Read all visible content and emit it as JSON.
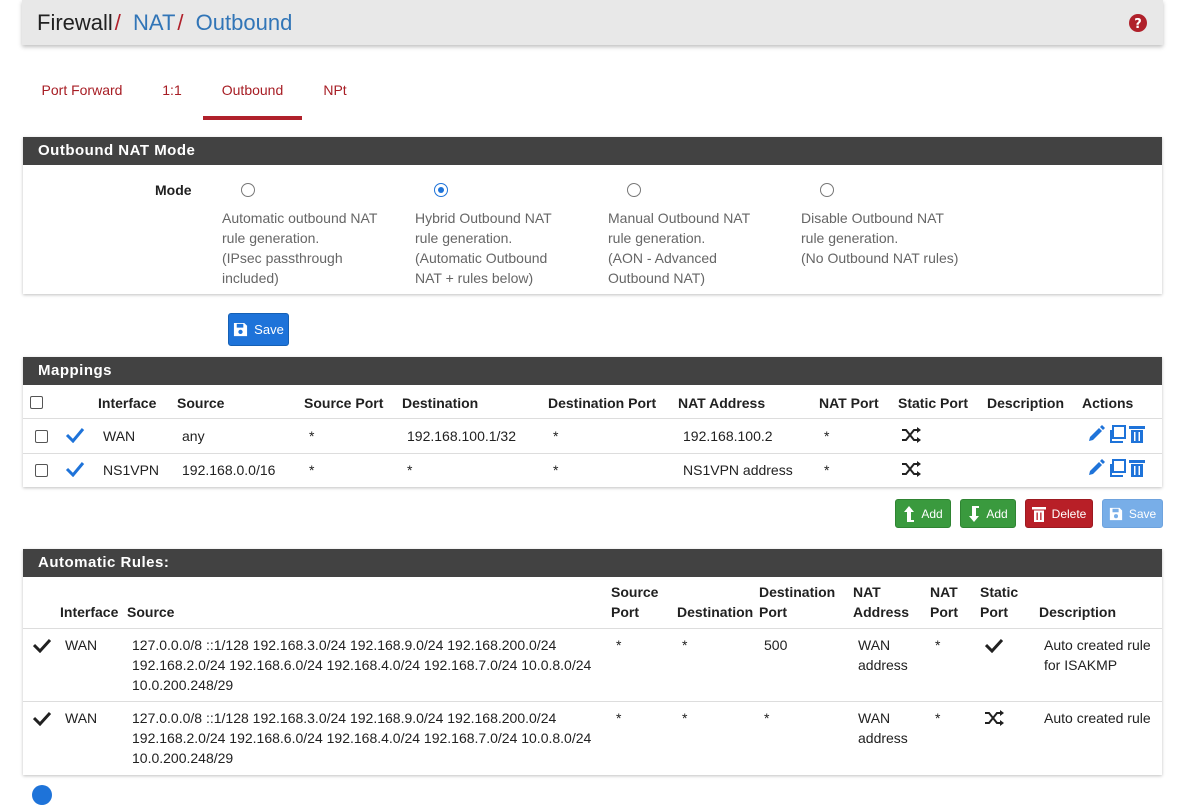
{
  "breadcrumb": {
    "first": "Firewall",
    "second": "NAT",
    "third": "Outbound",
    "separator": "/"
  },
  "tabs": [
    {
      "label": "Port Forward",
      "active": false
    },
    {
      "label": "1:1",
      "active": false
    },
    {
      "label": "Outbound",
      "active": true
    },
    {
      "label": "NPt",
      "active": false
    }
  ],
  "mode_panel": {
    "title": "Outbound NAT Mode",
    "mode_label": "Mode",
    "options": [
      {
        "lines": [
          "Automatic outbound NAT",
          "rule generation.",
          "(IPsec passthrough",
          "included)"
        ],
        "selected": false
      },
      {
        "lines": [
          "Hybrid Outbound NAT",
          "rule generation.",
          "(Automatic Outbound",
          "NAT + rules below)"
        ],
        "selected": true
      },
      {
        "lines": [
          "Manual Outbound NAT",
          "rule generation.",
          "(AON - Advanced",
          "Outbound NAT)"
        ],
        "selected": false
      },
      {
        "lines": [
          "Disable Outbound NAT",
          "rule generation.",
          "(No Outbound NAT rules)"
        ],
        "selected": false
      }
    ],
    "save_label": "Save"
  },
  "mappings": {
    "title": "Mappings",
    "headers": [
      "Interface",
      "Source",
      "Source Port",
      "Destination",
      "Destination Port",
      "NAT Address",
      "NAT Port",
      "Static Port",
      "Description",
      "Actions"
    ],
    "rows": [
      {
        "interface": "WAN",
        "source": "any",
        "source_port": "*",
        "destination": "192.168.100.1/32",
        "destination_port": "*",
        "nat_address": "192.168.100.2",
        "nat_port": "*",
        "static_port": "shuffle-icon",
        "description": ""
      },
      {
        "interface": "NS1VPN",
        "source": "192.168.0.0/16",
        "source_port": "*",
        "destination": "*",
        "destination_port": "*",
        "nat_address": "NS1VPN address",
        "nat_port": "*",
        "static_port": "shuffle-icon",
        "description": ""
      }
    ],
    "buttons": {
      "add_top": "Add",
      "add_bottom": "Add",
      "delete": "Delete",
      "save": "Save"
    }
  },
  "auto_rules": {
    "title": "Automatic Rules:",
    "headers": {
      "interface": "Interface",
      "source": "Source",
      "source_port": [
        "Source",
        "Port"
      ],
      "destination": "Destination",
      "destination_port": [
        "Destination",
        "Port"
      ],
      "nat_address": [
        "NAT",
        "Address"
      ],
      "nat_port": [
        "NAT",
        "Port"
      ],
      "static_port": [
        "Static",
        "Port"
      ],
      "description": "Description"
    },
    "rows": [
      {
        "interface": "WAN",
        "source_lines": [
          "127.0.0.0/8 ::1/128 192.168.3.0/24 192.168.9.0/24 192.168.200.0/24",
          "192.168.2.0/24 192.168.6.0/24 192.168.4.0/24 192.168.7.0/24 10.0.8.0/24",
          "10.0.200.248/29"
        ],
        "source_port": "*",
        "destination": "*",
        "destination_port": "500",
        "nat_address_lines": [
          "WAN",
          "address"
        ],
        "nat_port": "*",
        "static_port": "check-icon",
        "description_lines": [
          "Auto created rule",
          "for ISAKMP"
        ]
      },
      {
        "interface": "WAN",
        "source_lines": [
          "127.0.0.0/8 ::1/128 192.168.3.0/24 192.168.9.0/24 192.168.200.0/24",
          "192.168.2.0/24 192.168.6.0/24 192.168.4.0/24 192.168.7.0/24 10.0.8.0/24",
          "10.0.200.248/29"
        ],
        "source_port": "*",
        "destination": "*",
        "destination_port": "*",
        "nat_address_lines": [
          "WAN",
          "address"
        ],
        "nat_port": "*",
        "static_port": "shuffle-icon",
        "description_lines": [
          "Auto created rule"
        ]
      }
    ]
  },
  "colors": {
    "accent_red": "#b0212b",
    "link_blue": "#3175b7",
    "panel_header": "#424242",
    "btn_blue": "#1e73d9",
    "btn_green": "#3a9a3e",
    "btn_red": "#b81f27"
  }
}
